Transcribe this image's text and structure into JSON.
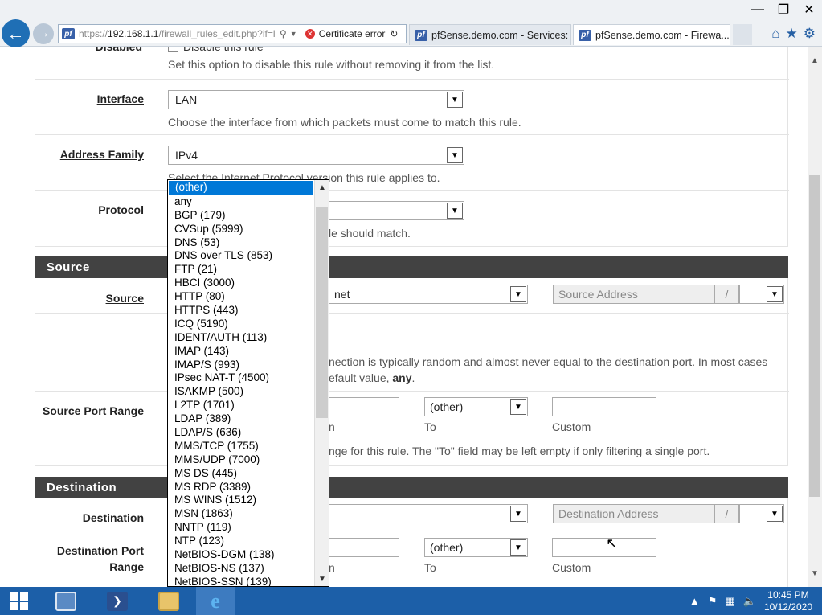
{
  "browser": {
    "url_prefix": "https://",
    "url_host": "192.168.1.1",
    "url_path": "/firewall_rules_edit.php?if=la",
    "cert_error": "Certificate error",
    "tabs": [
      {
        "label": "pfSense.demo.com - Services: ..."
      },
      {
        "label": "pfSense.demo.com - Firewa..."
      }
    ]
  },
  "form": {
    "disabled_label": "Disabled",
    "disabled_checkbox_text": "Disable this rule",
    "disabled_help": "Set this option to disable this rule without removing it from the list.",
    "interface_label": "Interface",
    "interface_value": "LAN",
    "interface_help": "Choose the interface from which packets must come to match this rule.",
    "address_family_label": "Address Family",
    "address_family_value": "IPv4",
    "address_family_help": "Select the Internet Protocol version this rule applies to.",
    "protocol_label": "Protocol",
    "protocol_help_tail": "le should match."
  },
  "source": {
    "section_title": "Source",
    "source_label": "Source",
    "source_select_tail": "net",
    "source_address_placeholder": "Source Address",
    "slash": "/",
    "port_help_tail_1": "nection is typically random and almost never equal to the destination port. In most cases",
    "port_help_tail_2_pre": "efault value, ",
    "port_help_tail_2_bold": "any",
    "port_help_tail_2_post": ".",
    "port_range_label": "Source Port Range",
    "from_fragment": "n",
    "to_value": "(other)",
    "to_label": "To",
    "custom_label": "Custom",
    "range_help_tail": "nge for this rule. The \"To\" field may be left empty if only filtering a single port."
  },
  "destination": {
    "section_title": "Destination",
    "destination_label": "Destination",
    "destination_address_placeholder": "Destination Address",
    "slash": "/",
    "port_range_label_1": "Destination Port",
    "port_range_label_2": "Range",
    "from_fragment": "n",
    "to_value": "(other)",
    "to_label": "To",
    "custom_label": "Custom"
  },
  "protocol_dropdown": {
    "selected": "(other)",
    "options": [
      "(other)",
      "any",
      "BGP (179)",
      "CVSup (5999)",
      "DNS (53)",
      "DNS over TLS (853)",
      "FTP (21)",
      "HBCI (3000)",
      "HTTP (80)",
      "HTTPS (443)",
      "ICQ (5190)",
      "IDENT/AUTH (113)",
      "IMAP (143)",
      "IMAP/S (993)",
      "IPsec NAT-T (4500)",
      "ISAKMP (500)",
      "L2TP (1701)",
      "LDAP (389)",
      "LDAP/S (636)",
      "MMS/TCP (1755)",
      "MMS/UDP (7000)",
      "MS DS (445)",
      "MS RDP (3389)",
      "MS WINS (1512)",
      "MSN (1863)",
      "NNTP (119)",
      "NTP (123)",
      "NetBIOS-DGM (138)",
      "NetBIOS-NS (137)",
      "NetBIOS-SSN (139)"
    ]
  },
  "taskbar": {
    "time": "10:45 PM",
    "date": "10/12/2020"
  }
}
